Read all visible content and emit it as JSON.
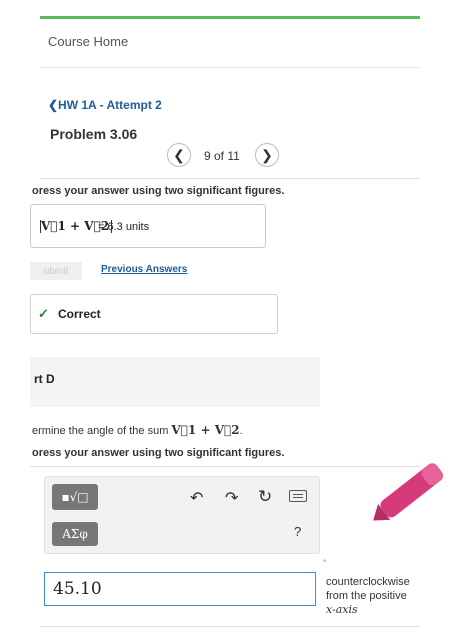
{
  "header": {
    "course_home": "Course Home",
    "back_link": "❮HW 1A - Attempt 2",
    "problem_title": "Problem 3.06",
    "pager": {
      "prev": "❮",
      "text": "9 of 11",
      "next": "❯"
    }
  },
  "part_c": {
    "instruction": "oress your answer using two significant figures.",
    "answer_expression": "V⃗1 + V⃗2",
    "answer_value": "= 6.3  units",
    "submit_label": "ubmit",
    "previous_answers_label": "Previous Answers",
    "feedback": {
      "icon": "✓",
      "text": "Correct"
    }
  },
  "part_d": {
    "heading": "rt D",
    "question_prefix": "ermine the angle of the sum ",
    "question_vector": "V⃗1 + V⃗2",
    "question_suffix": ".",
    "instruction": "oress your answer using two significant figures."
  },
  "editor": {
    "template_label": "▪√□",
    "greek_label": "ΑΣφ",
    "undo_glyph": "↶",
    "redo_glyph": "↷",
    "reset_glyph": "↻",
    "help_label": "?",
    "degree_symbol": "°",
    "input_value": "45.10",
    "unit_line1": "counterclockwise",
    "unit_line2": "from the positive",
    "unit_line3": "x-axis"
  },
  "colors": {
    "accent_green": "#5cb85c",
    "link_blue": "#1f5c99",
    "input_border": "#3a8fc9",
    "pen": "#d63a7a"
  },
  "icons": [
    "chevron-left-icon",
    "chevron-right-icon",
    "check-icon",
    "undo-icon",
    "redo-icon",
    "reset-icon",
    "keyboard-icon",
    "help-icon",
    "pen-cursor-icon"
  ]
}
